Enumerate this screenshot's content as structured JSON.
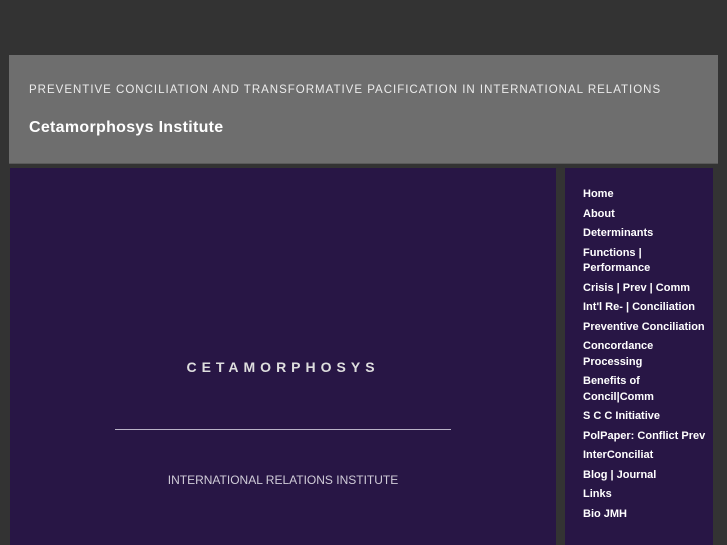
{
  "header": {
    "tagline": "PREVENTIVE CONCILIATION AND TRANSFORMATIVE PACIFICATION IN INTERNATIONAL RELATIONS",
    "site_title": "Cetamorphosys Institute"
  },
  "main": {
    "hero_title": "CETAMORPHOSYS",
    "hero_subtitle": "INTERNATIONAL RELATIONS INSTITUTE"
  },
  "sidebar": {
    "items": [
      {
        "label": "Home"
      },
      {
        "label": "About"
      },
      {
        "label": "Determinants"
      },
      {
        "label": "Functions | Performance"
      },
      {
        "label": "Crisis | Prev | Comm"
      },
      {
        "label": "Int'l Re- | Conciliation"
      },
      {
        "label": "Preventive Conciliation"
      },
      {
        "label": "Concordance Processing"
      },
      {
        "label": "Benefits of Concil|Comm"
      },
      {
        "label": "S C C Initiative"
      },
      {
        "label": "PolPaper: Conflict Prev"
      },
      {
        "label": "InterConciliat"
      },
      {
        "label": "Blog | Journal"
      },
      {
        "label": "Links"
      },
      {
        "label": "Bio JMH"
      }
    ]
  },
  "colors": {
    "page_background": "#333333",
    "header_background": "#6e6e6e",
    "content_background": "#281645",
    "text_light": "#ffffff"
  }
}
